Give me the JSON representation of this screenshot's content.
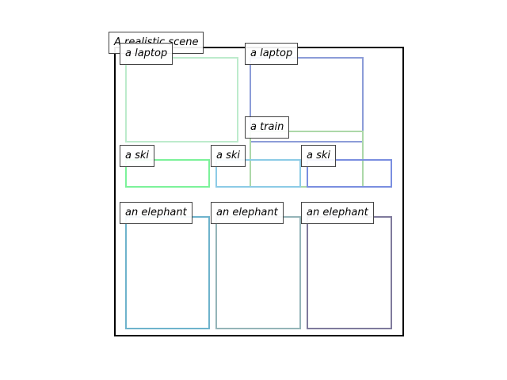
{
  "title": "A realistic scene",
  "objects": [
    {
      "label": "a laptop",
      "color": "#bdebcc"
    },
    {
      "label": "a laptop",
      "color": "#8c9cd8"
    },
    {
      "label": "a train",
      "color": "#acd8a8"
    },
    {
      "label": "a ski",
      "color": "#7cf29a"
    },
    {
      "label": "a ski",
      "color": "#8ccbe6"
    },
    {
      "label": "a ski",
      "color": "#7a8ee0"
    },
    {
      "label": "an elephant",
      "color": "#6eb3cc"
    },
    {
      "label": "an elephant",
      "color": "#94b4b8"
    },
    {
      "label": "an elephant",
      "color": "#7f7a9c"
    }
  ]
}
